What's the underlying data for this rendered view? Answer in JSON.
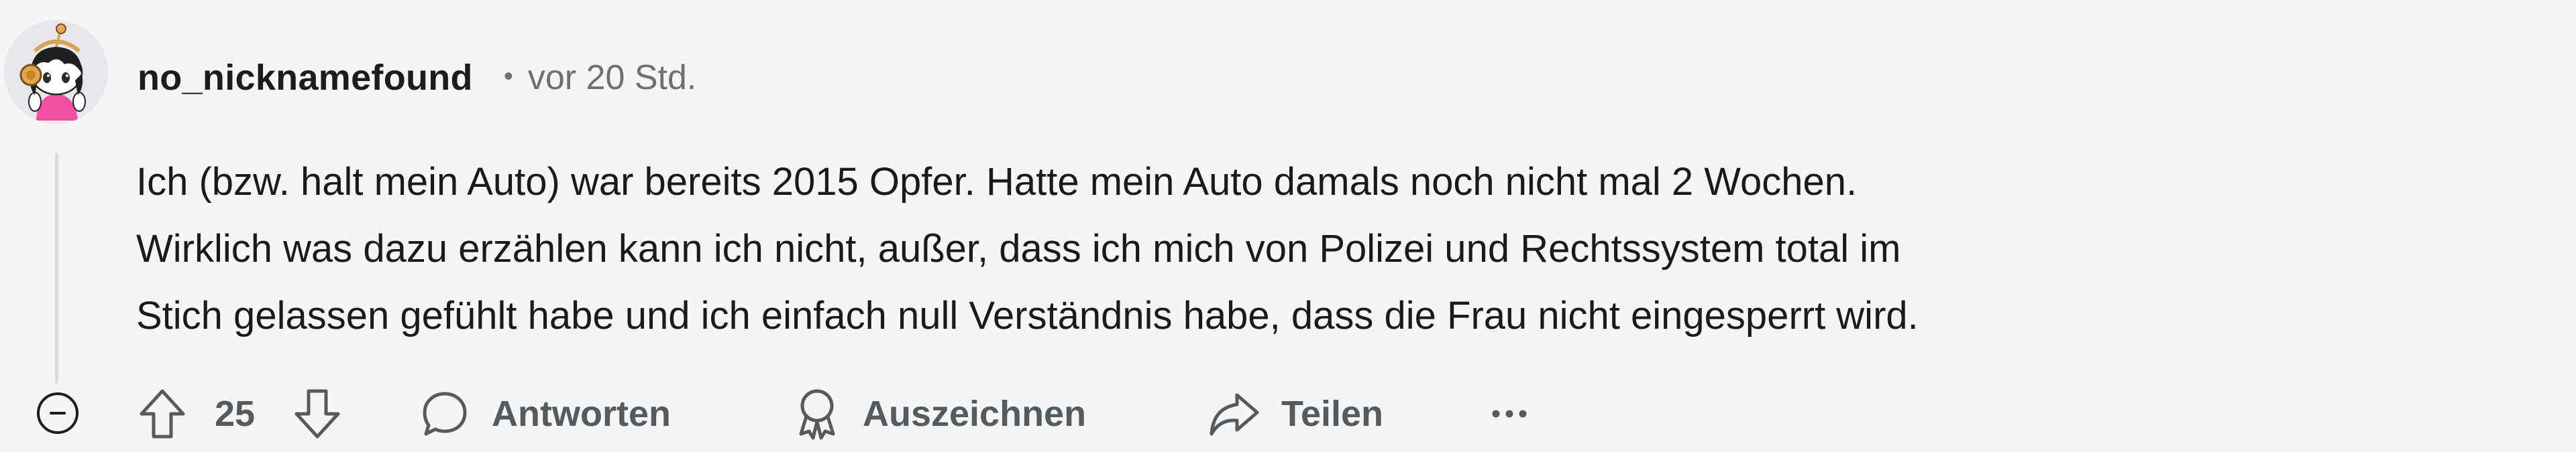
{
  "comment": {
    "author": "no_nicknamefound",
    "separator": "•",
    "time": "vor 20 Std.",
    "avatar_icon": "snoo-avatar-icon",
    "body": [
      "Ich (bzw. halt mein Auto) war bereits 2015 Opfer. Hatte mein Auto damals noch nicht mal 2 Wochen.",
      "Wirklich was dazu erzählen kann ich nicht, außer, dass ich mich von Polizei und Rechtssystem total im",
      "Stich gelassen gefühlt habe und ich einfach null Verständnis habe, dass die Frau nicht eingesperrt wird."
    ]
  },
  "actions": {
    "collapse_icon": "minus-circle-icon",
    "upvote_icon": "arrow-up-icon",
    "vote_count": "25",
    "downvote_icon": "arrow-down-icon",
    "reply_icon": "speech-bubble-icon",
    "reply_label": "Antworten",
    "award_icon": "award-icon",
    "award_label": "Auszeichnen",
    "share_icon": "share-arrow-icon",
    "share_label": "Teilen",
    "more_icon": "ellipsis-icon"
  },
  "colors": {
    "background": "#f5f5f5",
    "text": "#1a1a1b",
    "muted": "#6c6f73",
    "action": "#555a5e",
    "thread_line": "#d7dadc"
  }
}
